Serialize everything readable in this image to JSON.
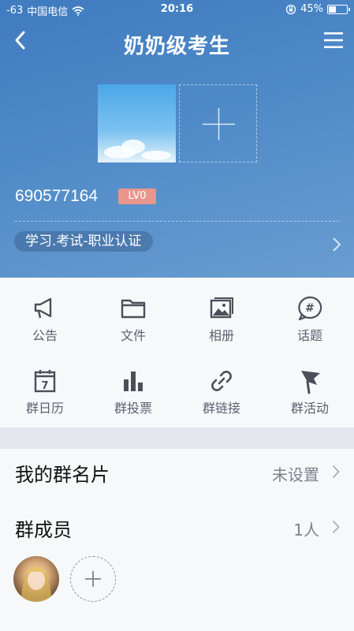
{
  "status_bar": {
    "signal": "-63",
    "carrier": "中国电信",
    "time": "20:16",
    "battery_percent": "45%",
    "battery_level": 0.45
  },
  "nav": {
    "title": "奶奶级考生"
  },
  "group": {
    "id": "690577164",
    "level": "LV0",
    "category": "学习.考试-职业认证"
  },
  "features": [
    {
      "label": "公告",
      "icon": "megaphone-icon"
    },
    {
      "label": "文件",
      "icon": "folder-icon"
    },
    {
      "label": "相册",
      "icon": "photo-album-icon"
    },
    {
      "label": "话题",
      "icon": "topic-hash-icon"
    },
    {
      "label": "群日历",
      "icon": "calendar-icon"
    },
    {
      "label": "群投票",
      "icon": "bar-chart-icon"
    },
    {
      "label": "群链接",
      "icon": "link-icon"
    },
    {
      "label": "群活动",
      "icon": "flag-icon"
    }
  ],
  "my_card": {
    "title": "我的群名片",
    "value": "未设置"
  },
  "members": {
    "title": "群成员",
    "count": "1人"
  },
  "colors": {
    "header_blue": "#4f8ac8",
    "level_badge": "#e8968e",
    "icon_gray": "#4a4f5a"
  }
}
